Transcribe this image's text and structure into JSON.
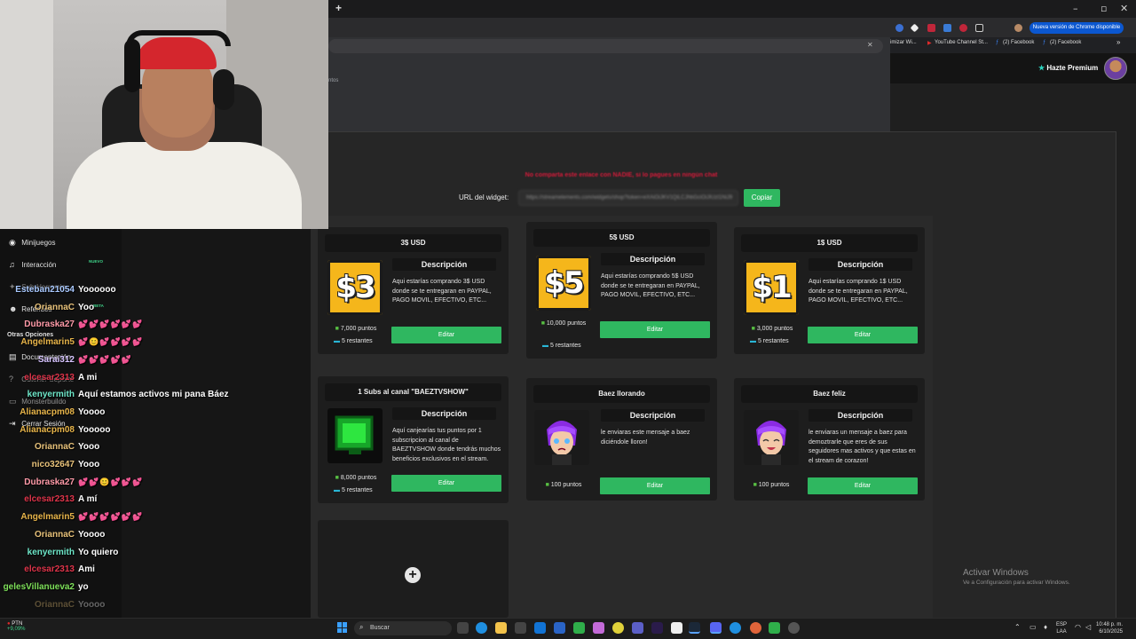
{
  "browser": {
    "new_tab": "+",
    "window_controls": [
      "–",
      "▫",
      "✕"
    ],
    "update_label": "Nueva versión de Chrome disponible",
    "bookmarks": [
      "rimizar Wi...",
      "YouTube Channel St...",
      "(2) Facebook",
      "(2) Facebook"
    ],
    "omnibox_fragments": [
      "ntos",
      "s"
    ],
    "omnibox_close": "✕"
  },
  "page_header": {
    "premium_star": "★",
    "premium_label": "Hazte Premium"
  },
  "widget": {
    "warning": "No comparta este enlace con NADIE, si lo pagues en ningún chat",
    "url_label": "URL del widget:",
    "url_value": "https://streamelements.com/widgets/shop?token=eXAiOiJKV1QiLCJhbGciOiJIUzI1NiJ9",
    "copy_label": "Copiar"
  },
  "rewards": [
    {
      "title": "3$ USD",
      "image": "$3",
      "desc_head": "Descripción",
      "desc": "Aqui estarías comprando 3$ USD donde se te entregaran en PAYPAL, PAGO MOVIL, EFECTIVO, ETC...",
      "points": "7,000 puntos",
      "remaining": "5 restantes",
      "button": "Editar"
    },
    {
      "title": "5$ USD",
      "image": "$5",
      "desc_head": "Descripción",
      "desc": "Aqui estarías comprando 5$ USD donde se te entregaran en PAYPAL, PAGO MOVIL, EFECTIVO, ETC...",
      "points": "10,000 puntos",
      "remaining": "5 restantes",
      "button": "Editar"
    },
    {
      "title": "1$ USD",
      "image": "$1",
      "desc_head": "Descripción",
      "desc": "Aqui estarías comprando 1$ USD donde se te entregaran en PAYPAL, PAGO MOVIL, EFECTIVO, ETC...",
      "points": "3,000 puntos",
      "remaining": "5 restantes",
      "button": "Editar"
    },
    {
      "title": "1 Subs al canal \"BAEZTVSHOW\"",
      "image": "monitor",
      "desc_head": "Descripción",
      "desc": "Aquí canjearías tus puntos por 1 subscripcion al canal de BAEZTVSHOW donde tendrás muchos beneficios exclusivos en el stream.",
      "points": "8,000 puntos",
      "remaining": "5 restantes",
      "button": "Editar"
    },
    {
      "title": "Baez llorando",
      "image": "anime-crying",
      "desc_head": "Descripción",
      "desc": "le enviaras este mensaje a baez diciéndole lloron!",
      "points": "100 puntos",
      "button": "Editar"
    },
    {
      "title": "Baez feliz",
      "image": "anime-happy",
      "desc_head": "Descripción",
      "desc": "le enviaras un mensaje a baez para demoztrarle que eres de sus seguidores mas activos y que estas en el stream de corazon!",
      "points": "100 puntos",
      "button": "Editar"
    }
  ],
  "add_card": {
    "icon": "+"
  },
  "watermark": {
    "title": "Activar Windows",
    "subtitle": "Ve a Configuración para activar Windows."
  },
  "sidebar": {
    "items": [
      {
        "icon": "gamepad-icon",
        "glyph": "◉",
        "label": "Minijuegos"
      },
      {
        "icon": "music-icon",
        "glyph": "♫",
        "label": "Interacción",
        "badge": "NUEVO"
      },
      {
        "icon": "puzzle-icon",
        "glyph": "✦",
        "label": "Sub-Herramie..."
      },
      {
        "icon": "users-icon",
        "glyph": "☻",
        "label": "Referidos",
        "badge": "BETA"
      },
      {
        "icon": "section",
        "glyph": "",
        "label": "Otras Opciones"
      },
      {
        "icon": "doc-icon",
        "glyph": "▤",
        "label": "Documentación"
      },
      {
        "icon": "help-icon",
        "glyph": "?",
        "label": "Obtener Soporte"
      },
      {
        "icon": "laptop-icon",
        "glyph": "▭",
        "label": "Monsterbuildo"
      },
      {
        "icon": "logout-icon",
        "glyph": "⇥",
        "label": "Cerrar Sesión"
      }
    ]
  },
  "chat": [
    {
      "user": "Esteban21054",
      "color": "#a9c9ff",
      "msg": "Yoooooo"
    },
    {
      "user": "OriannaC",
      "color": "#e8c27a",
      "msg": "Yoo"
    },
    {
      "user": "Dubraska27",
      "color": "#ff9aa8",
      "msg": "💕💕💕💕💕💕"
    },
    {
      "user": "Angelmarin5",
      "color": "#e8b54a",
      "msg": "💕😊💕💕💕💕"
    },
    {
      "user": "Sarai312",
      "color": "#d7c4ff",
      "msg": "💕💕💕💕💕"
    },
    {
      "user": "elcesar2313",
      "color": "#e0344a",
      "msg": "A mi"
    },
    {
      "user": "kenyermith",
      "color": "#6ee7c9",
      "msg": "Aquí estamos activos mi pana Báez"
    },
    {
      "user": "Alianacpm08",
      "color": "#e8b54a",
      "msg": "Yoooo"
    },
    {
      "user": "Alianacpm08",
      "color": "#e8b54a",
      "msg": "Yooooo"
    },
    {
      "user": "OriannaC",
      "color": "#e8c27a",
      "msg": "Yooo"
    },
    {
      "user": "nico32647",
      "color": "#e8c27a",
      "msg": "Yooo"
    },
    {
      "user": "Dubraska27",
      "color": "#ff9aa8",
      "msg": "💕💕😊💕💕💕"
    },
    {
      "user": "elcesar2313",
      "color": "#e0344a",
      "msg": "A mí"
    },
    {
      "user": "Angelmarin5",
      "color": "#e8b54a",
      "msg": "💕💕💕💕💕💕"
    },
    {
      "user": "OriannaC",
      "color": "#e8c27a",
      "msg": "Yoooo"
    },
    {
      "user": "kenyermith",
      "color": "#6ee7c9",
      "msg": "Yo quiero"
    },
    {
      "user": "elcesar2313",
      "color": "#e0344a",
      "msg": "Ami"
    },
    {
      "user": "gelesVillanueva2",
      "color": "#7ee05a",
      "msg": "yo"
    },
    {
      "user": "OriannaC",
      "color": "#e8c27a",
      "msg": "Yoooo"
    }
  ],
  "taskbar": {
    "stock_name": "PTN",
    "stock_change": "+9,09%",
    "search_placeholder": "Buscar",
    "lang": "ESP",
    "lang_sub": "LAA",
    "time": "10:48 p. m.",
    "date": "6/10/2025"
  },
  "colors": {
    "accent_green": "#2fb760",
    "warning_red": "#d31b3a",
    "coin_yellow": "#f5b61b"
  }
}
